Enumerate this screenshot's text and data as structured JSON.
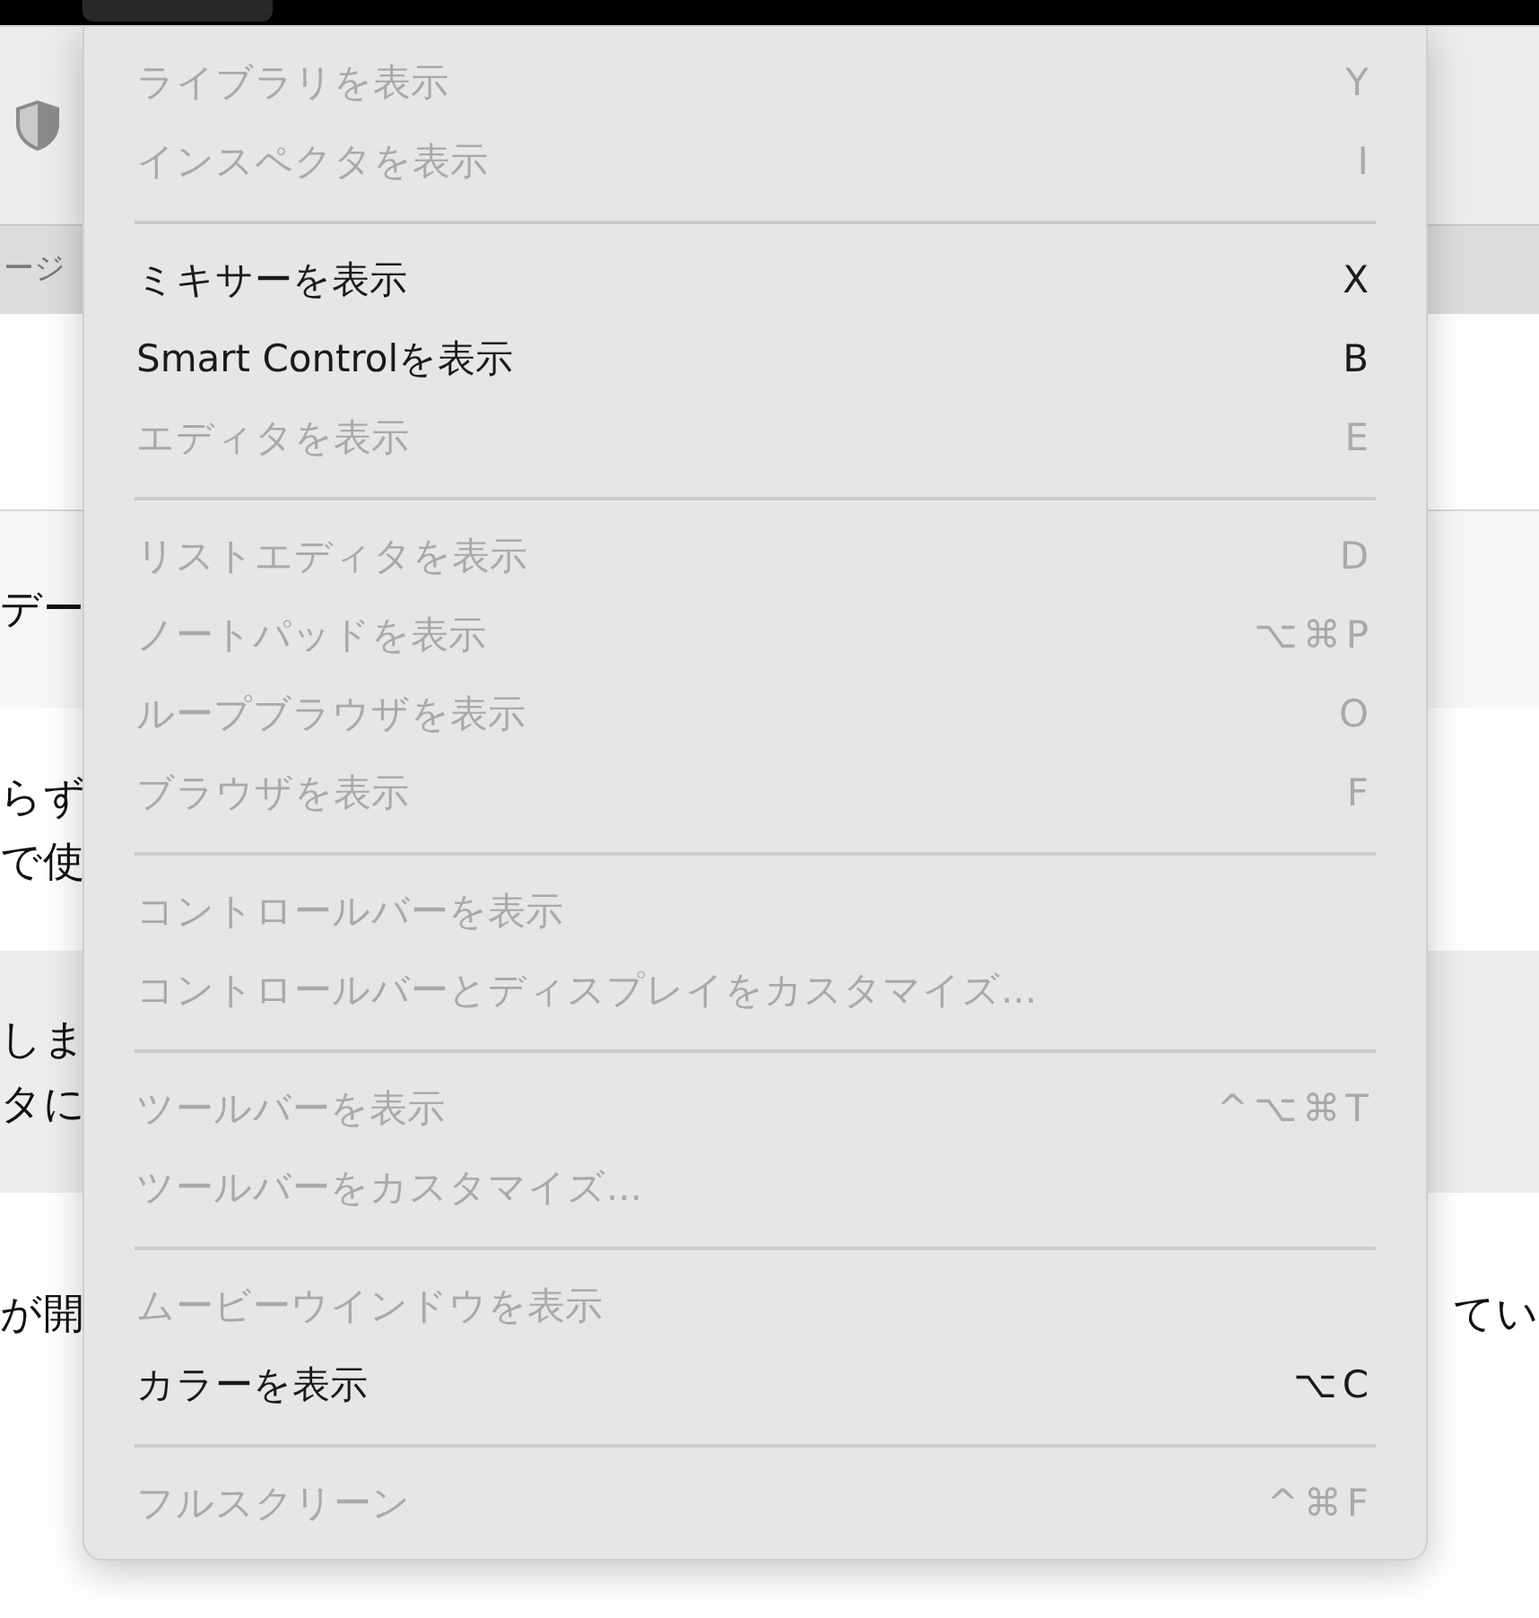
{
  "background": {
    "tab_fragment": "ージ",
    "sections": [
      {
        "kind": "light",
        "lines": [
          [
            "デー"
          ]
        ]
      },
      {
        "kind": "white",
        "lines": [
          [
            "らず"
          ],
          [
            "で使"
          ]
        ]
      },
      {
        "kind": "grey",
        "lines": [
          [
            "しま"
          ],
          [
            "タに"
          ]
        ]
      },
      {
        "kind": "white",
        "lines": [
          [
            "が開",
            "てい"
          ]
        ]
      }
    ]
  },
  "menu": {
    "sections": [
      [
        {
          "label": "ライブラリを表示",
          "shortcut": "Y",
          "enabled": false
        },
        {
          "label": "インスペクタを表示",
          "shortcut": "I",
          "enabled": false
        }
      ],
      [
        {
          "label": "ミキサーを表示",
          "shortcut": "X",
          "enabled": true
        },
        {
          "label": "Smart Controlを表示",
          "shortcut": "B",
          "enabled": true
        },
        {
          "label": "エディタを表示",
          "shortcut": "E",
          "enabled": false
        }
      ],
      [
        {
          "label": "リストエディタを表示",
          "shortcut": "D",
          "enabled": false
        },
        {
          "label": "ノートパッドを表示",
          "shortcut": "⌥⌘P",
          "enabled": false
        },
        {
          "label": "ループブラウザを表示",
          "shortcut": "O",
          "enabled": false
        },
        {
          "label": "ブラウザを表示",
          "shortcut": "F",
          "enabled": false
        }
      ],
      [
        {
          "label": "コントロールバーを表示",
          "enabled": false
        },
        {
          "label": "コントロールバーとディスプレイをカスタマイズ...",
          "enabled": false
        }
      ],
      [
        {
          "label": "ツールバーを表示",
          "shortcut": "^⌥⌘T",
          "enabled": false
        },
        {
          "label": "ツールバーをカスタマイズ...",
          "enabled": false
        }
      ],
      [
        {
          "label": "ムービーウインドウを表示",
          "enabled": false
        },
        {
          "label": "カラーを表示",
          "shortcut": "⌥C",
          "enabled": true
        }
      ],
      [
        {
          "label": "フルスクリーン",
          "shortcut": "^⌘F",
          "enabled": false
        }
      ]
    ]
  }
}
